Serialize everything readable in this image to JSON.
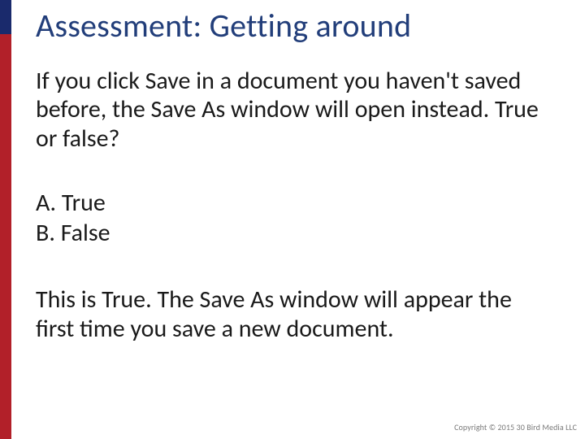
{
  "title": "Assessment: Getting around",
  "question": "If you click Save in a document you haven't saved before, the Save As window will open instead. True or false?",
  "options": [
    {
      "letter": "A.",
      "label": "True"
    },
    {
      "letter": "B.",
      "label": "False"
    }
  ],
  "explanation": "This is True. The Save As window will appear the first time you save a new document.",
  "copyright": "Copyright © 2015 30 Bird Media LLC",
  "colors": {
    "accentTop": "#1a2a6c",
    "accentBody": "#b22029",
    "title": "#223e7a"
  }
}
